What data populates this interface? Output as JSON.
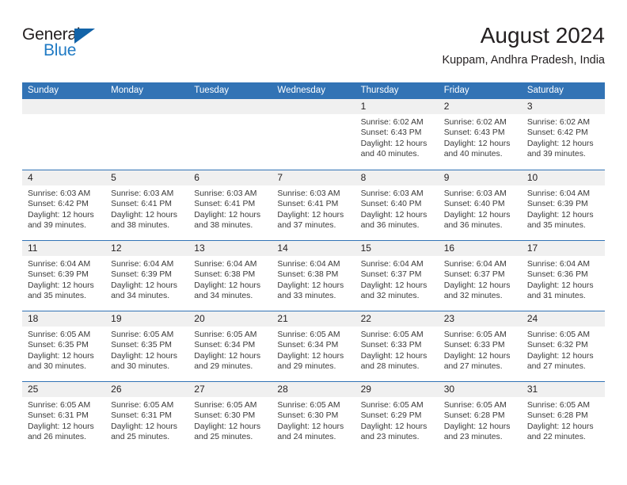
{
  "brand": {
    "name_top": "General",
    "name_bottom": "Blue",
    "accent_color": "#1f7ac4",
    "triangle_color": "#1263a8",
    "triangle_icon": "triangle-icon"
  },
  "header": {
    "title": "August 2024",
    "subtitle": "Kuppam, Andhra Pradesh, India"
  },
  "theme": {
    "header_blue": "#3273b5",
    "day_band_gray": "#f0f0f0",
    "text_color": "#231f20"
  },
  "weekdays": [
    "Sunday",
    "Monday",
    "Tuesday",
    "Wednesday",
    "Thursday",
    "Friday",
    "Saturday"
  ],
  "weeks": [
    [
      {
        "day": "",
        "sunrise": "",
        "sunset": "",
        "daylight_1": "",
        "daylight_2": "",
        "empty": true
      },
      {
        "day": "",
        "sunrise": "",
        "sunset": "",
        "daylight_1": "",
        "daylight_2": "",
        "empty": true
      },
      {
        "day": "",
        "sunrise": "",
        "sunset": "",
        "daylight_1": "",
        "daylight_2": "",
        "empty": true
      },
      {
        "day": "",
        "sunrise": "",
        "sunset": "",
        "daylight_1": "",
        "daylight_2": "",
        "empty": true
      },
      {
        "day": "1",
        "sunrise": "Sunrise: 6:02 AM",
        "sunset": "Sunset: 6:43 PM",
        "daylight_1": "Daylight: 12 hours",
        "daylight_2": "and 40 minutes.",
        "empty": false
      },
      {
        "day": "2",
        "sunrise": "Sunrise: 6:02 AM",
        "sunset": "Sunset: 6:43 PM",
        "daylight_1": "Daylight: 12 hours",
        "daylight_2": "and 40 minutes.",
        "empty": false
      },
      {
        "day": "3",
        "sunrise": "Sunrise: 6:02 AM",
        "sunset": "Sunset: 6:42 PM",
        "daylight_1": "Daylight: 12 hours",
        "daylight_2": "and 39 minutes.",
        "empty": false
      }
    ],
    [
      {
        "day": "4",
        "sunrise": "Sunrise: 6:03 AM",
        "sunset": "Sunset: 6:42 PM",
        "daylight_1": "Daylight: 12 hours",
        "daylight_2": "and 39 minutes.",
        "empty": false
      },
      {
        "day": "5",
        "sunrise": "Sunrise: 6:03 AM",
        "sunset": "Sunset: 6:41 PM",
        "daylight_1": "Daylight: 12 hours",
        "daylight_2": "and 38 minutes.",
        "empty": false
      },
      {
        "day": "6",
        "sunrise": "Sunrise: 6:03 AM",
        "sunset": "Sunset: 6:41 PM",
        "daylight_1": "Daylight: 12 hours",
        "daylight_2": "and 38 minutes.",
        "empty": false
      },
      {
        "day": "7",
        "sunrise": "Sunrise: 6:03 AM",
        "sunset": "Sunset: 6:41 PM",
        "daylight_1": "Daylight: 12 hours",
        "daylight_2": "and 37 minutes.",
        "empty": false
      },
      {
        "day": "8",
        "sunrise": "Sunrise: 6:03 AM",
        "sunset": "Sunset: 6:40 PM",
        "daylight_1": "Daylight: 12 hours",
        "daylight_2": "and 36 minutes.",
        "empty": false
      },
      {
        "day": "9",
        "sunrise": "Sunrise: 6:03 AM",
        "sunset": "Sunset: 6:40 PM",
        "daylight_1": "Daylight: 12 hours",
        "daylight_2": "and 36 minutes.",
        "empty": false
      },
      {
        "day": "10",
        "sunrise": "Sunrise: 6:04 AM",
        "sunset": "Sunset: 6:39 PM",
        "daylight_1": "Daylight: 12 hours",
        "daylight_2": "and 35 minutes.",
        "empty": false
      }
    ],
    [
      {
        "day": "11",
        "sunrise": "Sunrise: 6:04 AM",
        "sunset": "Sunset: 6:39 PM",
        "daylight_1": "Daylight: 12 hours",
        "daylight_2": "and 35 minutes.",
        "empty": false
      },
      {
        "day": "12",
        "sunrise": "Sunrise: 6:04 AM",
        "sunset": "Sunset: 6:39 PM",
        "daylight_1": "Daylight: 12 hours",
        "daylight_2": "and 34 minutes.",
        "empty": false
      },
      {
        "day": "13",
        "sunrise": "Sunrise: 6:04 AM",
        "sunset": "Sunset: 6:38 PM",
        "daylight_1": "Daylight: 12 hours",
        "daylight_2": "and 34 minutes.",
        "empty": false
      },
      {
        "day": "14",
        "sunrise": "Sunrise: 6:04 AM",
        "sunset": "Sunset: 6:38 PM",
        "daylight_1": "Daylight: 12 hours",
        "daylight_2": "and 33 minutes.",
        "empty": false
      },
      {
        "day": "15",
        "sunrise": "Sunrise: 6:04 AM",
        "sunset": "Sunset: 6:37 PM",
        "daylight_1": "Daylight: 12 hours",
        "daylight_2": "and 32 minutes.",
        "empty": false
      },
      {
        "day": "16",
        "sunrise": "Sunrise: 6:04 AM",
        "sunset": "Sunset: 6:37 PM",
        "daylight_1": "Daylight: 12 hours",
        "daylight_2": "and 32 minutes.",
        "empty": false
      },
      {
        "day": "17",
        "sunrise": "Sunrise: 6:04 AM",
        "sunset": "Sunset: 6:36 PM",
        "daylight_1": "Daylight: 12 hours",
        "daylight_2": "and 31 minutes.",
        "empty": false
      }
    ],
    [
      {
        "day": "18",
        "sunrise": "Sunrise: 6:05 AM",
        "sunset": "Sunset: 6:35 PM",
        "daylight_1": "Daylight: 12 hours",
        "daylight_2": "and 30 minutes.",
        "empty": false
      },
      {
        "day": "19",
        "sunrise": "Sunrise: 6:05 AM",
        "sunset": "Sunset: 6:35 PM",
        "daylight_1": "Daylight: 12 hours",
        "daylight_2": "and 30 minutes.",
        "empty": false
      },
      {
        "day": "20",
        "sunrise": "Sunrise: 6:05 AM",
        "sunset": "Sunset: 6:34 PM",
        "daylight_1": "Daylight: 12 hours",
        "daylight_2": "and 29 minutes.",
        "empty": false
      },
      {
        "day": "21",
        "sunrise": "Sunrise: 6:05 AM",
        "sunset": "Sunset: 6:34 PM",
        "daylight_1": "Daylight: 12 hours",
        "daylight_2": "and 29 minutes.",
        "empty": false
      },
      {
        "day": "22",
        "sunrise": "Sunrise: 6:05 AM",
        "sunset": "Sunset: 6:33 PM",
        "daylight_1": "Daylight: 12 hours",
        "daylight_2": "and 28 minutes.",
        "empty": false
      },
      {
        "day": "23",
        "sunrise": "Sunrise: 6:05 AM",
        "sunset": "Sunset: 6:33 PM",
        "daylight_1": "Daylight: 12 hours",
        "daylight_2": "and 27 minutes.",
        "empty": false
      },
      {
        "day": "24",
        "sunrise": "Sunrise: 6:05 AM",
        "sunset": "Sunset: 6:32 PM",
        "daylight_1": "Daylight: 12 hours",
        "daylight_2": "and 27 minutes.",
        "empty": false
      }
    ],
    [
      {
        "day": "25",
        "sunrise": "Sunrise: 6:05 AM",
        "sunset": "Sunset: 6:31 PM",
        "daylight_1": "Daylight: 12 hours",
        "daylight_2": "and 26 minutes.",
        "empty": false
      },
      {
        "day": "26",
        "sunrise": "Sunrise: 6:05 AM",
        "sunset": "Sunset: 6:31 PM",
        "daylight_1": "Daylight: 12 hours",
        "daylight_2": "and 25 minutes.",
        "empty": false
      },
      {
        "day": "27",
        "sunrise": "Sunrise: 6:05 AM",
        "sunset": "Sunset: 6:30 PM",
        "daylight_1": "Daylight: 12 hours",
        "daylight_2": "and 25 minutes.",
        "empty": false
      },
      {
        "day": "28",
        "sunrise": "Sunrise: 6:05 AM",
        "sunset": "Sunset: 6:30 PM",
        "daylight_1": "Daylight: 12 hours",
        "daylight_2": "and 24 minutes.",
        "empty": false
      },
      {
        "day": "29",
        "sunrise": "Sunrise: 6:05 AM",
        "sunset": "Sunset: 6:29 PM",
        "daylight_1": "Daylight: 12 hours",
        "daylight_2": "and 23 minutes.",
        "empty": false
      },
      {
        "day": "30",
        "sunrise": "Sunrise: 6:05 AM",
        "sunset": "Sunset: 6:28 PM",
        "daylight_1": "Daylight: 12 hours",
        "daylight_2": "and 23 minutes.",
        "empty": false
      },
      {
        "day": "31",
        "sunrise": "Sunrise: 6:05 AM",
        "sunset": "Sunset: 6:28 PM",
        "daylight_1": "Daylight: 12 hours",
        "daylight_2": "and 22 minutes.",
        "empty": false
      }
    ]
  ]
}
